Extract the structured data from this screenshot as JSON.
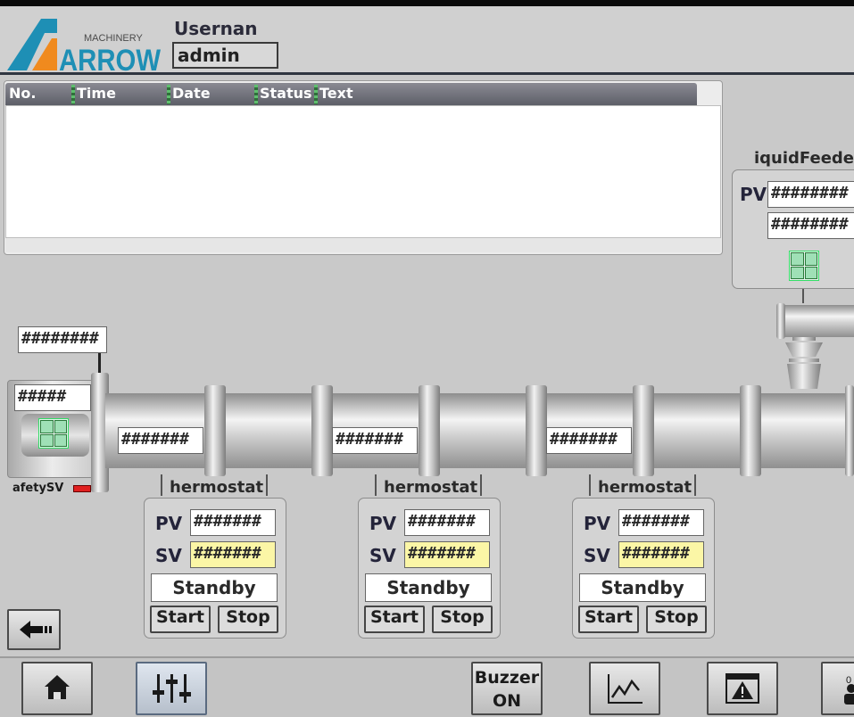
{
  "header": {
    "logo_small": "MACHINERY",
    "logo_text": "ARROW",
    "user_label": "Usernan",
    "user_value": "admin"
  },
  "alarm_table": {
    "columns": [
      "No.",
      "Time",
      "Date",
      "Status",
      "Text"
    ],
    "rows": []
  },
  "motor": {
    "top_value": "########",
    "speed_value": "#####",
    "safety_label": "afetySV"
  },
  "feeder": {
    "title": "iquidFeede",
    "pv_label": "PV",
    "pv_value": "########",
    "sv_value": "########"
  },
  "zones": [
    {
      "pipe_value": "#######",
      "title": "hermostat",
      "pv_label": "PV",
      "pv_value": "#######",
      "sv_label": "SV",
      "sv_value": "#######",
      "status": "Standby",
      "start_label": "Start",
      "stop_label": "Stop"
    },
    {
      "pipe_value": "#######",
      "title": "hermostat",
      "pv_label": "PV",
      "pv_value": "#######",
      "sv_label": "SV",
      "sv_value": "#######",
      "status": "Standby",
      "start_label": "Start",
      "stop_label": "Stop"
    },
    {
      "pipe_value": "#######",
      "title": "hermostat",
      "pv_label": "PV",
      "pv_value": "#######",
      "sv_label": "SV",
      "sv_value": "#######",
      "status": "Standby",
      "start_label": "Start",
      "stop_label": "Stop"
    }
  ],
  "nav": {
    "buzzer_line1": "Buzzer",
    "buzzer_line2": "ON",
    "user_partial": "0"
  },
  "colors": {
    "sv_yellow": "#fbf6a6",
    "alarm_header": "#6a6c75",
    "indicator_red": "#e02020"
  }
}
